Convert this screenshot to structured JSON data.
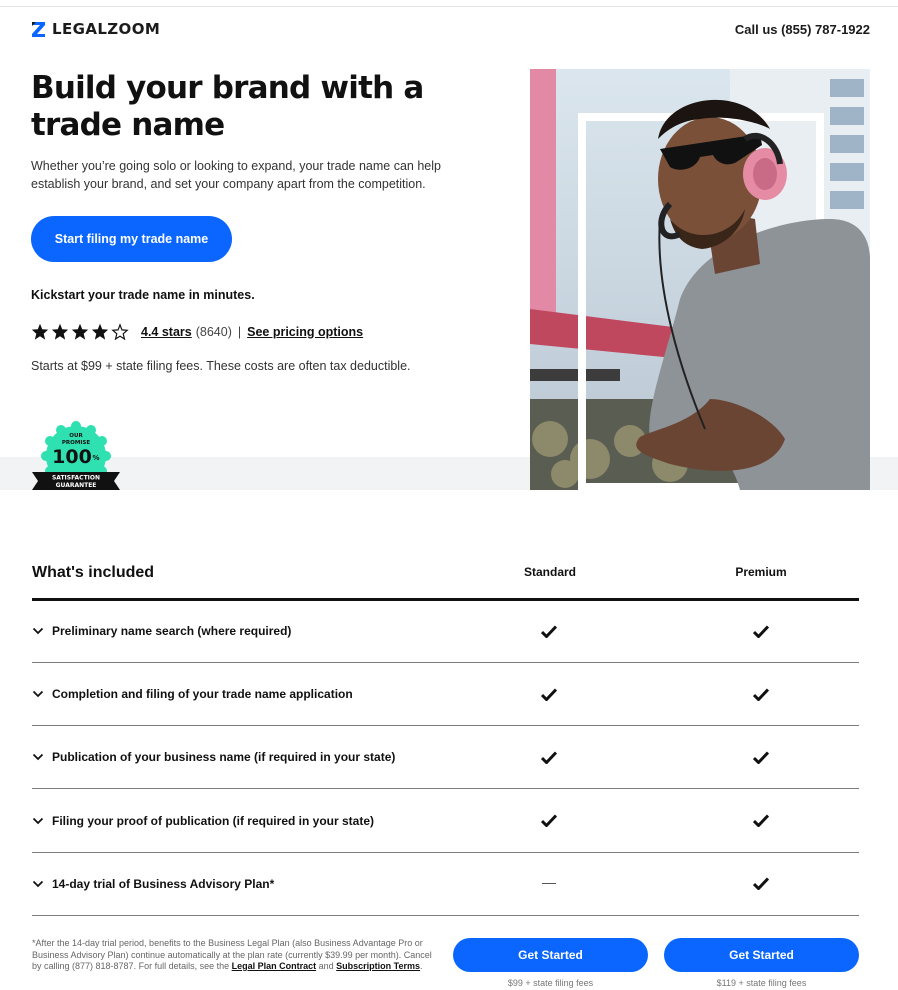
{
  "header": {
    "logo_text": "LEGALZOOM",
    "call_us": "Call us (855) 787-1922"
  },
  "hero": {
    "title": "Build your brand with a trade name",
    "description": "Whether you’re going solo or looking to expand, your trade name can help establish your brand, and set your company apart from the competition.",
    "cta_label": "Start filing my trade name",
    "kickstart": "Kickstart your trade name in minutes.",
    "rating": {
      "stars_filled": 4,
      "stars_total": 5,
      "stars_label": "4.4 stars",
      "count": "(8640)",
      "separator": "|",
      "pricing_link": "See pricing options"
    },
    "price_note": "Starts at $99 + state filing fees. These costs are often tax deductible.",
    "badge": {
      "line1": "OUR",
      "line2": "PROMISE",
      "big": "100",
      "pct": "%",
      "ribbon1": "SATISFACTION",
      "ribbon2": "GUARANTEE"
    }
  },
  "table": {
    "title": "What's included",
    "columns": [
      "Standard",
      "Premium"
    ],
    "rows": [
      {
        "label": "Preliminary name search (where required)",
        "standard": "check",
        "premium": "check"
      },
      {
        "label": "Completion and filing of your trade name application",
        "standard": "check",
        "premium": "check"
      },
      {
        "label": "Publication of your business name (if required in your state)",
        "standard": "check",
        "premium": "check"
      },
      {
        "label": "Filing your proof of publication (if required in your state)",
        "standard": "check",
        "premium": "check"
      },
      {
        "label": "14-day trial of Business Advisory Plan*",
        "standard": "dash",
        "premium": "check"
      }
    ]
  },
  "footnote": {
    "text": "*After the 14-day trial period, benefits to the Business Legal Plan (also Business Advantage Pro or Business Advisory Plan) continue automatically at the plan rate (currently $39.99 per month). Cancel by calling (877) 818-8787. For full details, see the ",
    "link1": "Legal Plan Contract",
    "and": " and ",
    "link2": "Subscription Terms",
    "end": "."
  },
  "plans": [
    {
      "button": "Get Started",
      "fee": "$99 + state filing fees"
    },
    {
      "button": "Get Started",
      "fee": "$119 + state filing fees"
    }
  ],
  "colors": {
    "accent": "#0a66ff",
    "badge_green": "#2fe0b0",
    "text": "#1b1b1b"
  }
}
